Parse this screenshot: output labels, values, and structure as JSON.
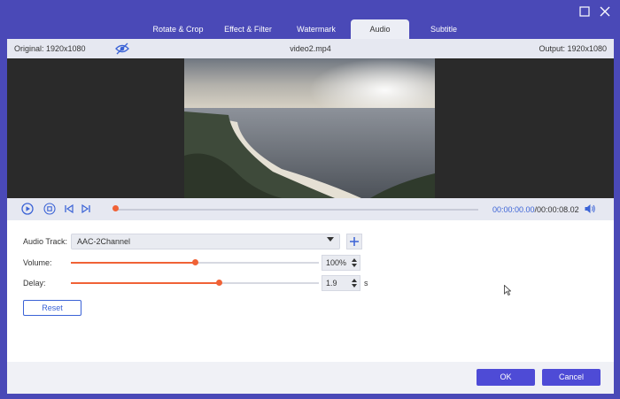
{
  "tabs": [
    {
      "label": "Rotate & Crop",
      "active": false
    },
    {
      "label": "Effect & Filter",
      "active": false
    },
    {
      "label": "Watermark",
      "active": false
    },
    {
      "label": "Audio",
      "active": true
    },
    {
      "label": "Subtitle",
      "active": false
    }
  ],
  "infobar": {
    "original": "Original: 1920x1080",
    "filename": "video2.mp4",
    "output": "Output: 1920x1080"
  },
  "player": {
    "current_time": "00:00:00.00",
    "total_time": "/00:00:08.02",
    "progress": 0
  },
  "audio": {
    "track_label": "Audio Track:",
    "track_value": "AAC-2Channel",
    "volume_label": "Volume:",
    "volume_value": "100%",
    "volume_level": 0.5,
    "delay_label": "Delay:",
    "delay_value": "1.9",
    "delay_unit": "s",
    "delay_level": 0.595,
    "reset_label": "Reset"
  },
  "footer": {
    "ok_label": "OK",
    "cancel_label": "Cancel"
  },
  "colors": {
    "brand": "#4a49b7",
    "accent": "#f06236",
    "link": "#3b63d6"
  }
}
